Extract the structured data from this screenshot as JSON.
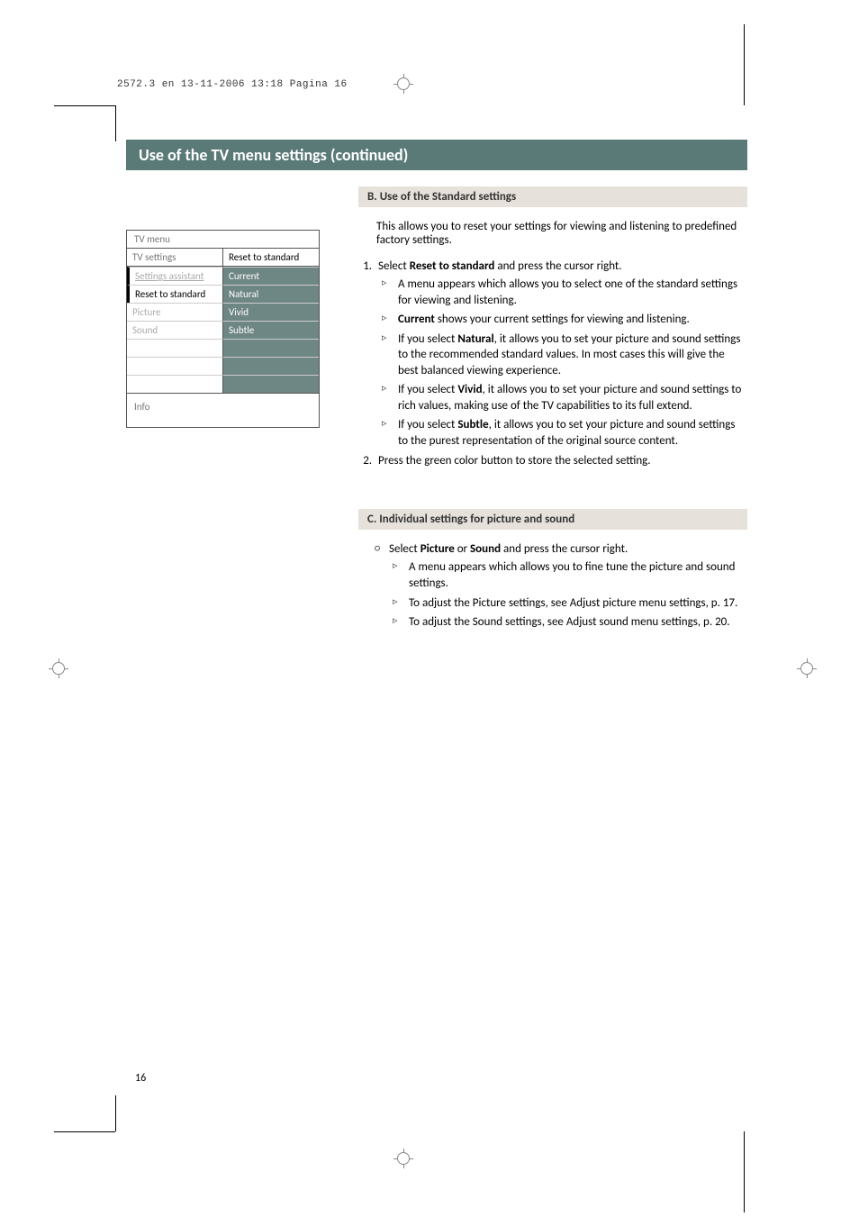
{
  "header_line": "2572.3 en  13-11-2006  13:18  Pagina 16",
  "banner": "Use of the TV menu settings  (continued)",
  "section_b": {
    "heading": "B. Use of the Standard settings",
    "intro": "This allows you to reset your settings for viewing and listening to predefined factory settings.",
    "steps": {
      "s1": {
        "lead": "Select ",
        "bold": "Reset to standard",
        "tail": " and press the cursor right.",
        "bullets": {
          "b1": "A menu appears which allows you to select one of the standard settings for viewing and listening.",
          "b2": {
            "bold": "Current",
            "tail": " shows your current settings for viewing and listening."
          },
          "b3": {
            "lead": "If you select ",
            "bold": "Natural",
            "tail": ", it allows you to set your picture and sound settings to the recommended standard values. In most cases this will give the best balanced viewing experience."
          },
          "b4": {
            "lead": "If you select ",
            "bold": "Vivid",
            "tail": ", it allows you to set your picture and sound settings to rich values, making use of the TV capabilities to its full extend."
          },
          "b5": {
            "lead": "If you select ",
            "bold": "Subtle",
            "tail": ", it allows you to set your picture and sound settings to the purest representation of the original source content."
          }
        }
      },
      "s2": "Press the green color button to store the selected setting."
    }
  },
  "section_c": {
    "heading": "C. Individual settings for picture and sound",
    "item": {
      "lead": "Select ",
      "b1": "Picture",
      "mid": " or ",
      "b2": "Sound",
      "tail": " and press the cursor right.",
      "bullets": {
        "c1": "A menu appears which allows you to fine tune the picture and sound settings.",
        "c2": "To adjust the Picture settings, see Adjust picture menu settings, p. 17.",
        "c3": "To adjust the Sound settings, see Adjust sound menu settings, p. 20."
      }
    }
  },
  "menu": {
    "title": "TV menu",
    "col1_header": "TV settings",
    "col2_header": "Reset to standard",
    "rows": {
      "r1": {
        "c1": "Settings assistant",
        "c2": "Current"
      },
      "r2": {
        "c1": "Reset to standard",
        "c2": "Natural"
      },
      "r3": {
        "c1": "Picture",
        "c2": "Vivid"
      },
      "r4": {
        "c1": "Sound",
        "c2": "Subtle"
      }
    },
    "info": "Info"
  },
  "page_number": "16"
}
